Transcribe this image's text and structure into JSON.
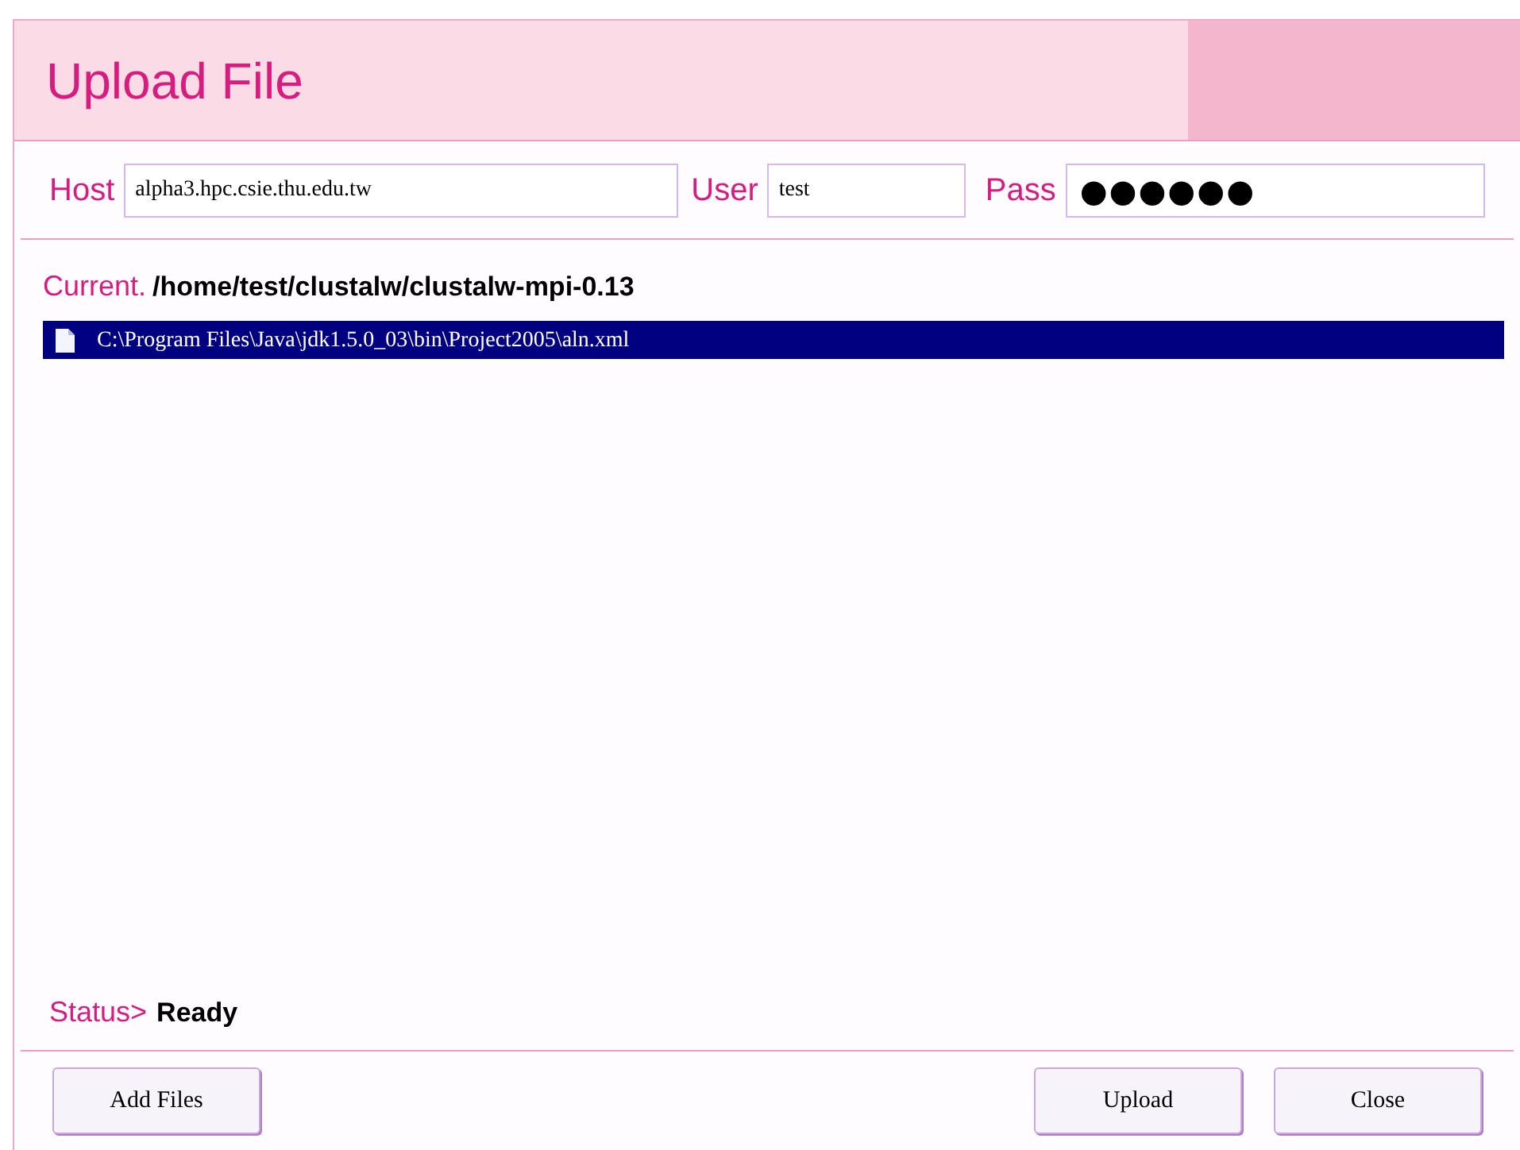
{
  "window": {
    "title": "Upload File"
  },
  "connection": {
    "host_label": "Host",
    "host_value": "alpha3.hpc.csie.thu.edu.tw",
    "user_label": "User",
    "user_value": "test",
    "pass_label": "Pass",
    "pass_value": "●●●●●●"
  },
  "current": {
    "label": "Current.",
    "path": "/home/test/clustalw/clustalw-mpi-0.13"
  },
  "files": [
    {
      "name": "C:\\Program Files\\Java\\jdk1.5.0_03\\bin\\Project2005\\aln.xml",
      "selected": true
    }
  ],
  "status": {
    "label": "Status>",
    "value": "Ready"
  },
  "buttons": {
    "left": [
      "Add Files"
    ],
    "right": [
      "Upload",
      "Close"
    ]
  }
}
